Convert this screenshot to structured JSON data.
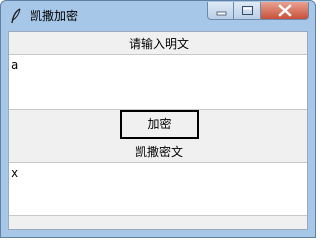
{
  "window": {
    "title": "凯撒加密",
    "controls": [
      "minimize",
      "maximize",
      "close"
    ]
  },
  "form": {
    "plaintext_label": "请输入明文",
    "plaintext_value": "a",
    "encrypt_button": "加密",
    "ciphertext_label": "凯撒密文",
    "ciphertext_value": "x"
  },
  "icons": {
    "app": "feather-icon",
    "minimize": "minimize-icon",
    "maximize": "maximize-icon",
    "close": "close-icon"
  },
  "colors": {
    "title_bar": "#a7c7e8",
    "close_button": "#c7503a",
    "client_background": "#f0f0f0"
  }
}
